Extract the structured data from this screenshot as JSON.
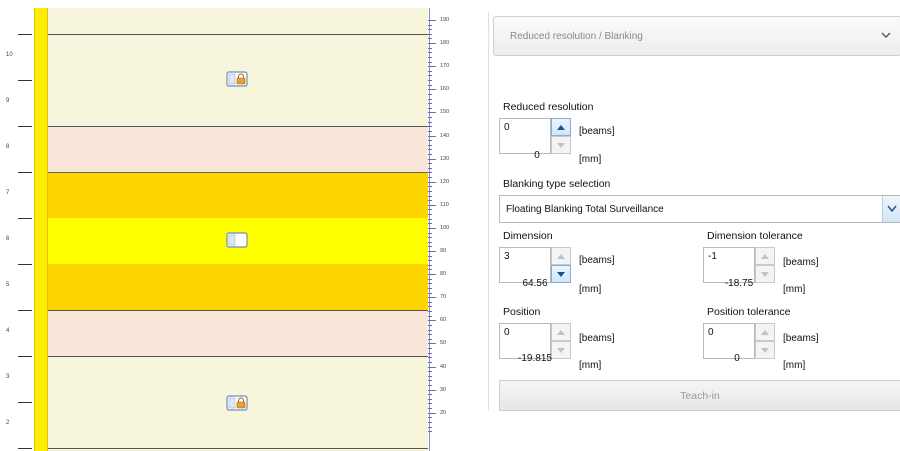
{
  "visualization": {
    "left_scale_labels": [
      "10",
      "9",
      "8",
      "7",
      "6",
      "5",
      "4",
      "3",
      "2"
    ],
    "right_scale_labels": [
      "190",
      "180",
      "170",
      "160",
      "150",
      "140",
      "130",
      "120",
      "110",
      "100",
      "90",
      "80",
      "70",
      "60",
      "50",
      "40",
      "30",
      "20"
    ],
    "icons": [
      "beam-lock-icon",
      "beam-blank-icon",
      "beam-lock-icon"
    ]
  },
  "panel": {
    "section_title": "Reduced resolution / Blanking",
    "reduced_resolution": {
      "label": "Reduced resolution",
      "value": "0",
      "unit_beams": "[beams]",
      "mm_value": "0",
      "unit_mm": "[mm]"
    },
    "blanking": {
      "label": "Blanking type selection",
      "selected": "Floating Blanking Total Surveillance"
    },
    "dimension": {
      "label": "Dimension",
      "value": "3",
      "unit_beams": "[beams]",
      "mm_value": "64.56",
      "unit_mm": "[mm]"
    },
    "dimension_tolerance": {
      "label": "Dimension tolerance",
      "value": "-1",
      "unit_beams": "[beams]",
      "mm_value": "-18.75",
      "unit_mm": "[mm]"
    },
    "position": {
      "label": "Position",
      "value": "0",
      "unit_beams": "[beams]",
      "mm_value": "-19.815",
      "unit_mm": "[mm]"
    },
    "position_tolerance": {
      "label": "Position tolerance",
      "value": "0",
      "unit_beams": "[beams]",
      "mm_value": "0",
      "unit_mm": "[mm]"
    },
    "teach_in_label": "Teach-in"
  },
  "colors": {
    "beam_bar": "#ffee00",
    "zone_normal": "#f7f5dc",
    "zone_tolerance": "#f9e6d8",
    "zone_dimension": "#ffd500",
    "zone_position": "#ffff00",
    "ruler": "#8a8ac8"
  }
}
